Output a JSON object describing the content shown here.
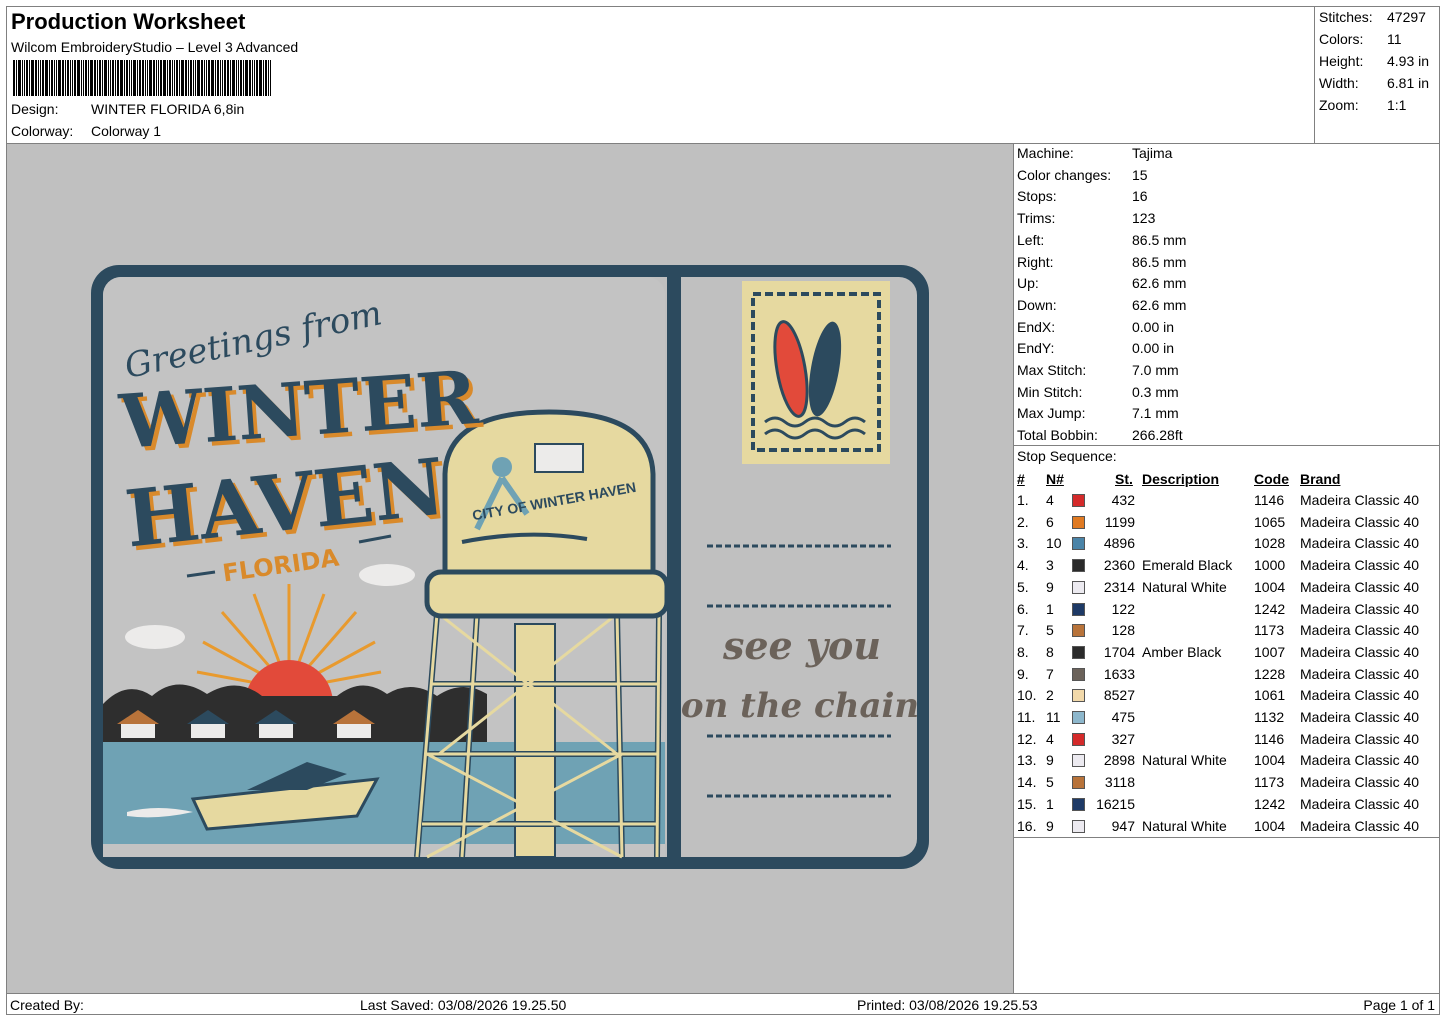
{
  "header": {
    "title": "Production Worksheet",
    "software": "Wilcom EmbroideryStudio – Level 3 Advanced",
    "design_label": "Design:",
    "design_value": "WINTER FLORIDA 6,8in",
    "colorway_label": "Colorway:",
    "colorway_value": "Colorway 1"
  },
  "stats": [
    {
      "label": "Stitches:",
      "value": "47297"
    },
    {
      "label": "Colors:",
      "value": "11"
    },
    {
      "label": "Height:",
      "value": "4.93 in"
    },
    {
      "label": "Width:",
      "value": "6.81 in"
    },
    {
      "label": "Zoom:",
      "value": "1:1"
    }
  ],
  "machine_info": [
    {
      "label": "Machine:",
      "value": "Tajima"
    },
    {
      "label": "Color changes:",
      "value": "15"
    },
    {
      "label": "Stops:",
      "value": "16"
    },
    {
      "label": "Trims:",
      "value": "123"
    },
    {
      "label": "Left:",
      "value": "86.5 mm"
    },
    {
      "label": "Right:",
      "value": "86.5 mm"
    },
    {
      "label": "Up:",
      "value": "62.6 mm"
    },
    {
      "label": "Down:",
      "value": "62.6 mm"
    },
    {
      "label": "EndX:",
      "value": "0.00 in"
    },
    {
      "label": "EndY:",
      "value": "0.00 in"
    },
    {
      "label": "Max Stitch:",
      "value": "7.0 mm"
    },
    {
      "label": "Min Stitch:",
      "value": "0.3 mm"
    },
    {
      "label": "Max Jump:",
      "value": "7.1 mm"
    },
    {
      "label": "Total Bobbin:",
      "value": "266.28ft"
    }
  ],
  "stop_sequence": {
    "title": "Stop Sequence:",
    "columns": {
      "num": "#",
      "needle": "N#",
      "stitches": "St.",
      "description": "Description",
      "code": "Code",
      "brand": "Brand"
    },
    "rows": [
      {
        "num": "1.",
        "needle": "4",
        "color": "#d42a2a",
        "stitches": "432",
        "description": "",
        "code": "1146",
        "brand": "Madeira Classic 40"
      },
      {
        "num": "2.",
        "needle": "6",
        "color": "#e07a22",
        "stitches": "1199",
        "description": "",
        "code": "1065",
        "brand": "Madeira Classic 40"
      },
      {
        "num": "3.",
        "needle": "10",
        "color": "#4a84a8",
        "stitches": "4896",
        "description": "",
        "code": "1028",
        "brand": "Madeira Classic 40"
      },
      {
        "num": "4.",
        "needle": "3",
        "color": "#2a2a2a",
        "stitches": "2360",
        "description": "Emerald Black",
        "code": "1000",
        "brand": "Madeira Classic 40"
      },
      {
        "num": "5.",
        "needle": "9",
        "color": "#eceaf0",
        "stitches": "2314",
        "description": "Natural White",
        "code": "1004",
        "brand": "Madeira Classic 40"
      },
      {
        "num": "6.",
        "needle": "1",
        "color": "#1e3a66",
        "stitches": "122",
        "description": "",
        "code": "1242",
        "brand": "Madeira Classic 40"
      },
      {
        "num": "7.",
        "needle": "5",
        "color": "#b8733a",
        "stitches": "128",
        "description": "",
        "code": "1173",
        "brand": "Madeira Classic 40"
      },
      {
        "num": "8.",
        "needle": "8",
        "color": "#2b2b2b",
        "stitches": "1704",
        "description": "Amber Black",
        "code": "1007",
        "brand": "Madeira Classic 40"
      },
      {
        "num": "9.",
        "needle": "7",
        "color": "#6b625a",
        "stitches": "1633",
        "description": "",
        "code": "1228",
        "brand": "Madeira Classic 40"
      },
      {
        "num": "10.",
        "needle": "2",
        "color": "#f2d9aa",
        "stitches": "8527",
        "description": "",
        "code": "1061",
        "brand": "Madeira Classic 40"
      },
      {
        "num": "11.",
        "needle": "11",
        "color": "#8db7cc",
        "stitches": "475",
        "description": "",
        "code": "1132",
        "brand": "Madeira Classic 40"
      },
      {
        "num": "12.",
        "needle": "4",
        "color": "#d42a2a",
        "stitches": "327",
        "description": "",
        "code": "1146",
        "brand": "Madeira Classic 40"
      },
      {
        "num": "13.",
        "needle": "9",
        "color": "#eceaf0",
        "stitches": "2898",
        "description": "Natural White",
        "code": "1004",
        "brand": "Madeira Classic 40"
      },
      {
        "num": "14.",
        "needle": "5",
        "color": "#b8733a",
        "stitches": "3118",
        "description": "",
        "code": "1173",
        "brand": "Madeira Classic 40"
      },
      {
        "num": "15.",
        "needle": "1",
        "color": "#1e3a66",
        "stitches": "16215",
        "description": "",
        "code": "1242",
        "brand": "Madeira Classic 40"
      },
      {
        "num": "16.",
        "needle": "9",
        "color": "#eceaf0",
        "stitches": "947",
        "description": "Natural White",
        "code": "1004",
        "brand": "Madeira Classic 40"
      }
    ]
  },
  "design_art": {
    "greeting": "Greetings from",
    "line1": "WINTER",
    "line2": "HAVEN",
    "state": "FLORIDA",
    "tower_text": "CITY OF WINTER HAVEN",
    "message_line1": "see you",
    "message_line2": "on the chain",
    "colors": {
      "navy": "#2c4a5e",
      "orange": "#d98a2b",
      "cream": "#e6d9a0",
      "water": "#6fa2b4",
      "sun": "#e24a3a"
    }
  },
  "footer": {
    "created_by": "Created By:",
    "last_saved": "Last Saved: 03/08/2026 19.25.50",
    "printed": "Printed: 03/08/2026 19.25.53",
    "page": "Page 1 of 1"
  }
}
